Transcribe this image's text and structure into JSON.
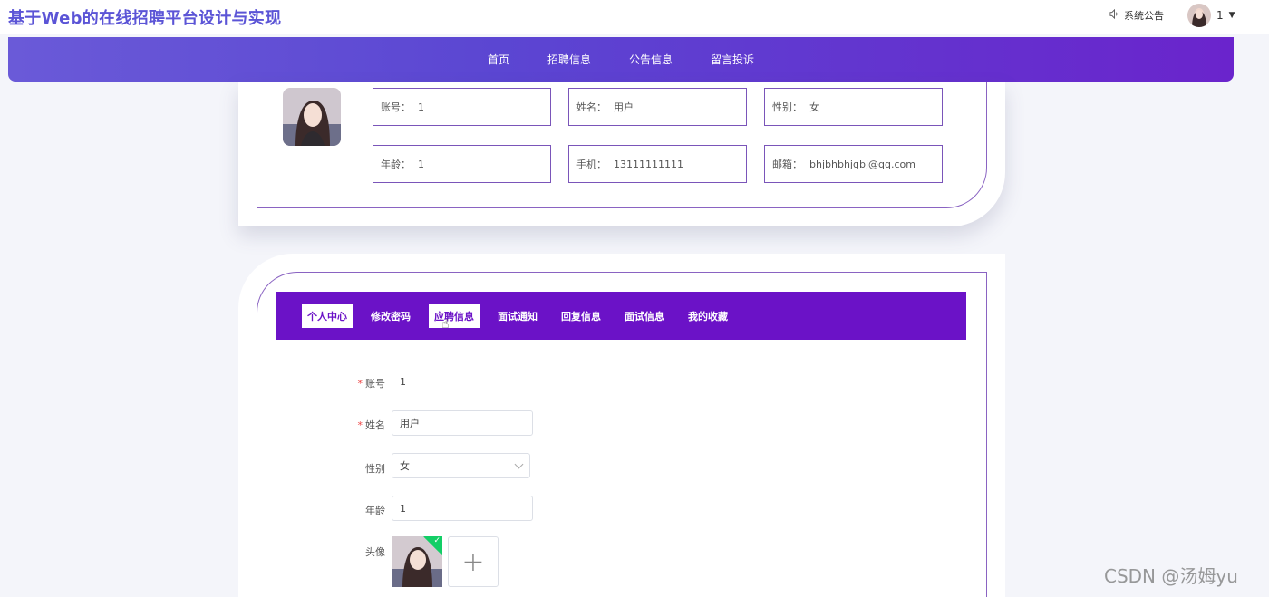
{
  "header": {
    "title": "基于Web的在线招聘平台设计与实现",
    "notice_label": "系统公告",
    "user_name": "1"
  },
  "nav": {
    "items": [
      "首页",
      "招聘信息",
      "公告信息",
      "留言投诉"
    ]
  },
  "profile_card": {
    "fields": [
      {
        "label": "账号：",
        "value": "1"
      },
      {
        "label": "姓名：",
        "value": "用户"
      },
      {
        "label": "性别：",
        "value": "女"
      },
      {
        "label": "年龄：",
        "value": "1"
      },
      {
        "label": "手机：",
        "value": "13111111111"
      },
      {
        "label": "邮箱：",
        "value": "bhjbhbhjgbj@qq.com"
      }
    ]
  },
  "tabs": {
    "items": [
      "个人中心",
      "修改密码",
      "应聘信息",
      "面试通知",
      "回复信息",
      "面试信息",
      "我的收藏"
    ],
    "active_index": 0,
    "hover_index": 2
  },
  "form": {
    "account_label": "账号",
    "account_value": "1",
    "name_label": "姓名",
    "name_value": "用户",
    "gender_label": "性别",
    "gender_value": "女",
    "age_label": "年龄",
    "age_value": "1",
    "avatar_label": "头像",
    "add_symbol": "+"
  },
  "watermark": "CSDN @汤姆yu",
  "colors": {
    "brand": "#5b54d6",
    "tab_bar": "#6b12c7",
    "card_border": "#8a63c2"
  }
}
